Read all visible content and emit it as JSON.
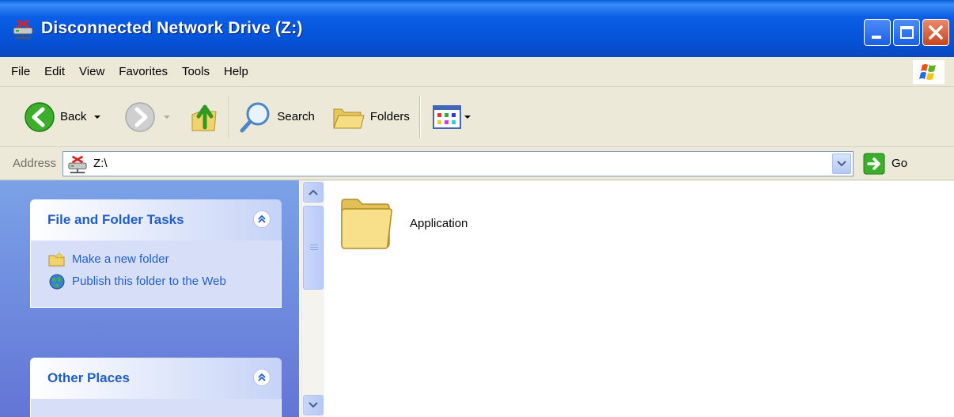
{
  "window": {
    "title": "Disconnected Network Drive (Z:)",
    "title_icon": "network-drive-icon"
  },
  "menu": {
    "items": [
      {
        "label": "File"
      },
      {
        "label": "Edit"
      },
      {
        "label": "View"
      },
      {
        "label": "Favorites"
      },
      {
        "label": "Tools"
      },
      {
        "label": "Help"
      }
    ]
  },
  "toolbar": {
    "back_label": "Back",
    "search_label": "Search",
    "folders_label": "Folders"
  },
  "address": {
    "label": "Address",
    "value": "Z:\\",
    "go_label": "Go"
  },
  "taskpane": {
    "file_tasks": {
      "title": "File and Folder Tasks",
      "links": [
        {
          "label": "Make a new folder",
          "icon": "new-folder-icon"
        },
        {
          "label": "Publish this folder to the Web",
          "icon": "globe-icon"
        }
      ]
    },
    "other_places": {
      "title": "Other Places"
    }
  },
  "content": {
    "items": [
      {
        "label": "Application",
        "icon": "folder-icon"
      }
    ]
  },
  "colors": {
    "titlebar": "#0553d8",
    "task_title": "#215dc6",
    "task_pane_bg": "#7ba2e7"
  }
}
